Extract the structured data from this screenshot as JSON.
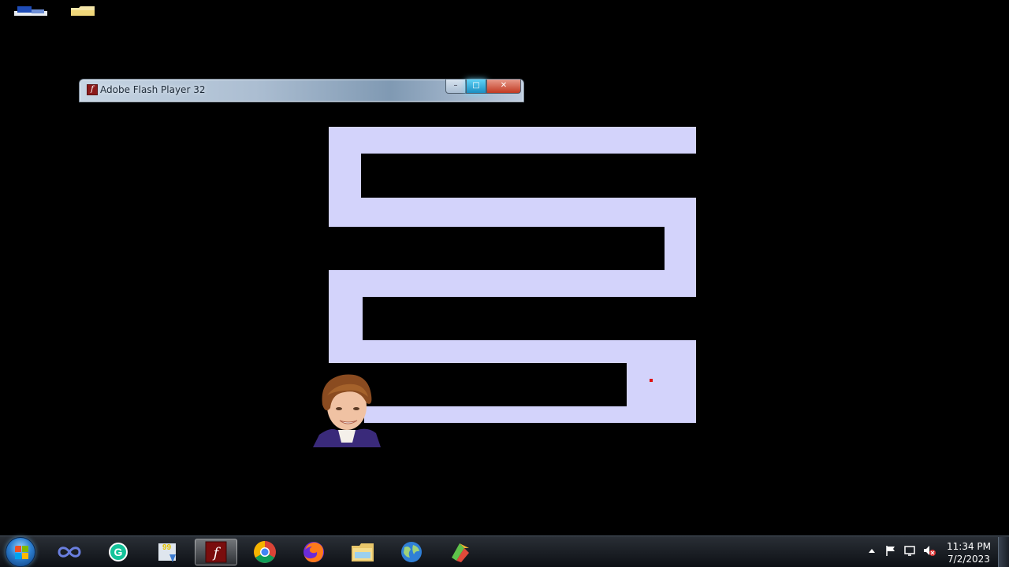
{
  "window": {
    "title": "Adobe Flash Player 32",
    "minimize_label": "–",
    "maximize_label": "□",
    "close_label": "✕"
  },
  "desktop": {
    "icons": [
      "computer-icon",
      "folder-icon"
    ]
  },
  "game": {
    "maze_color": "#d3d3fb",
    "background": "#000000",
    "goal_color": "#e01010"
  },
  "taskbar": {
    "items": [
      "start-orb",
      "infinity-app-icon",
      "grammarly-icon",
      "99-app-icon",
      "flash-player-icon",
      "chrome-icon",
      "firefox-icon",
      "file-explorer-icon",
      "globe-icon",
      "colorful-app-icon"
    ],
    "active_item": "flash-player-icon"
  },
  "tray": {
    "icons": [
      "show-hidden-icons-arrow",
      "action-center-flag-icon",
      "network-icon",
      "volume-muted-icon"
    ],
    "time": "11:34 PM",
    "date": "7/2/2023"
  }
}
